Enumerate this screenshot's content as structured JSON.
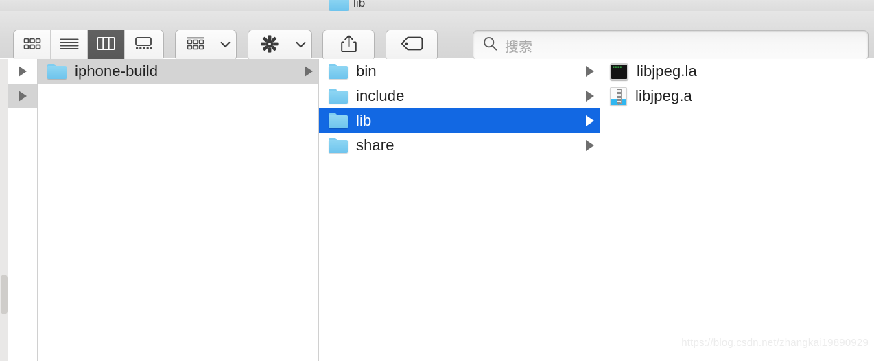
{
  "window": {
    "title": "lib",
    "title_icon": "folder-icon"
  },
  "toolbar": {
    "view_modes": [
      {
        "name": "icon-view",
        "icon": "icon-view-icon",
        "active": false
      },
      {
        "name": "list-view",
        "icon": "list-view-icon",
        "active": false
      },
      {
        "name": "column-view",
        "icon": "column-view-icon",
        "active": true
      },
      {
        "name": "gallery-view",
        "icon": "gallery-view-icon",
        "active": false
      }
    ],
    "group_button": {
      "icon": "group-items-icon",
      "chevron": "chevron-down-icon"
    },
    "action_button": {
      "icon": "gear-icon",
      "chevron": "chevron-down-icon"
    },
    "share_button": {
      "icon": "share-icon"
    },
    "tag_button": {
      "icon": "tag-icon"
    },
    "search": {
      "icon": "search-icon",
      "placeholder": "搜索",
      "value": ""
    }
  },
  "columns": [
    {
      "name": "column-stub",
      "items": [
        {
          "label": "",
          "icon": "",
          "selected": false,
          "has_chevron": true
        },
        {
          "label": "",
          "icon": "",
          "selected": true,
          "has_chevron": true
        }
      ]
    },
    {
      "name": "column-one",
      "items": [
        {
          "label": "iphone-build",
          "icon": "folder-icon",
          "selected": true,
          "selection": "inactive",
          "has_chevron": true
        }
      ]
    },
    {
      "name": "column-two",
      "items": [
        {
          "label": "bin",
          "icon": "folder-icon",
          "selected": false,
          "has_chevron": true
        },
        {
          "label": "include",
          "icon": "folder-icon",
          "selected": false,
          "has_chevron": true
        },
        {
          "label": "lib",
          "icon": "folder-icon",
          "selected": true,
          "selection": "active",
          "has_chevron": true
        },
        {
          "label": "share",
          "icon": "folder-icon",
          "selected": false,
          "has_chevron": true
        }
      ]
    },
    {
      "name": "column-three",
      "items": [
        {
          "label": "libjpeg.la",
          "icon": "unix-executable-icon",
          "selected": false,
          "has_chevron": false
        },
        {
          "label": "libjpeg.a",
          "icon": "archive-icon",
          "selected": false,
          "has_chevron": false
        }
      ]
    }
  ],
  "exec_icon_code": "▪▪▪▪",
  "watermark": "https://blog.csdn.net/zhangkai19890929",
  "colors": {
    "selection_active": "#1268e3",
    "selection_inactive": "#d4d4d4",
    "folder": "#6ec4ed",
    "toolbar_bg": "#dbdbdb",
    "active_segment": "#5a5a5a"
  }
}
